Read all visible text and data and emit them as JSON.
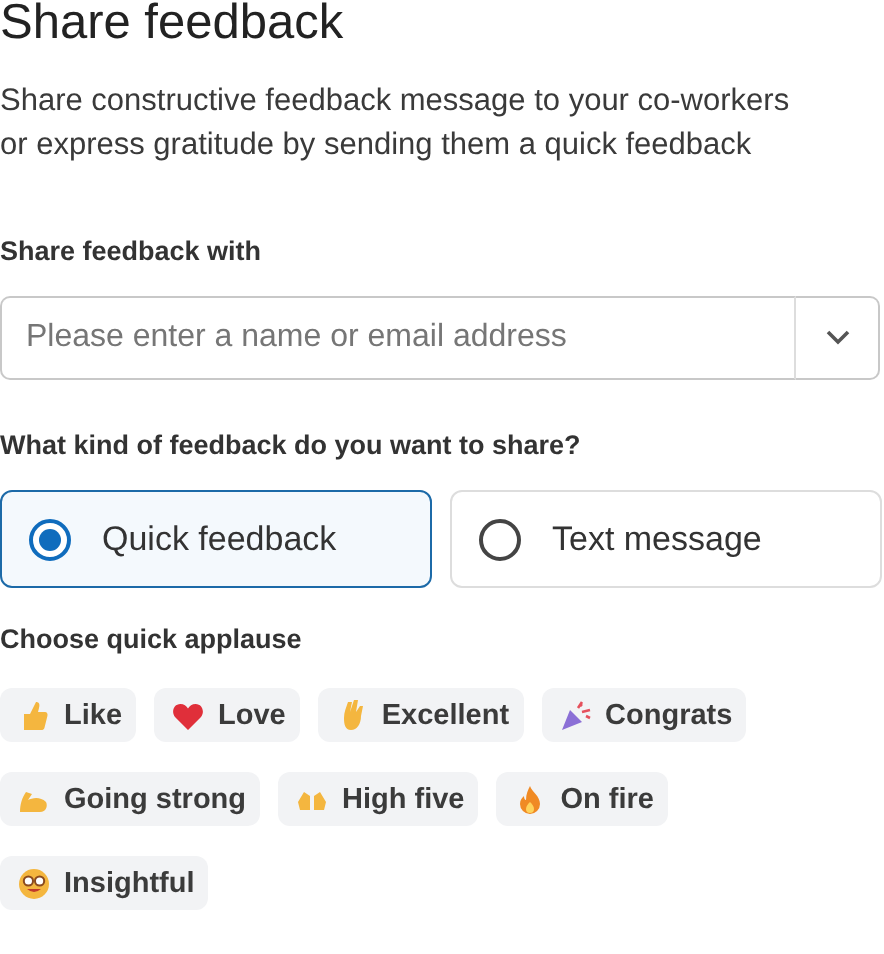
{
  "title": "Share feedback",
  "description": "Share constructive feedback message to your co-workers or express gratitude by sending them a quick feedback",
  "recipient": {
    "label": "Share feedback with",
    "placeholder": "Please enter a name or email address"
  },
  "feedback_type": {
    "label": "What kind of feedback do you want to share?",
    "options": [
      {
        "label": "Quick feedback",
        "selected": true
      },
      {
        "label": "Text message",
        "selected": false
      }
    ]
  },
  "applause": {
    "label": "Choose quick applause",
    "chips": [
      {
        "label": "Like",
        "kind": "thumb"
      },
      {
        "label": "Love",
        "kind": "heart"
      },
      {
        "label": "Excellent",
        "kind": "ok"
      },
      {
        "label": "Congrats",
        "kind": "party"
      },
      {
        "label": "Going strong",
        "kind": "muscle"
      },
      {
        "label": "High five",
        "kind": "hands"
      },
      {
        "label": "On fire",
        "kind": "fire"
      },
      {
        "label": "Insightful",
        "kind": "nerd"
      }
    ]
  }
}
